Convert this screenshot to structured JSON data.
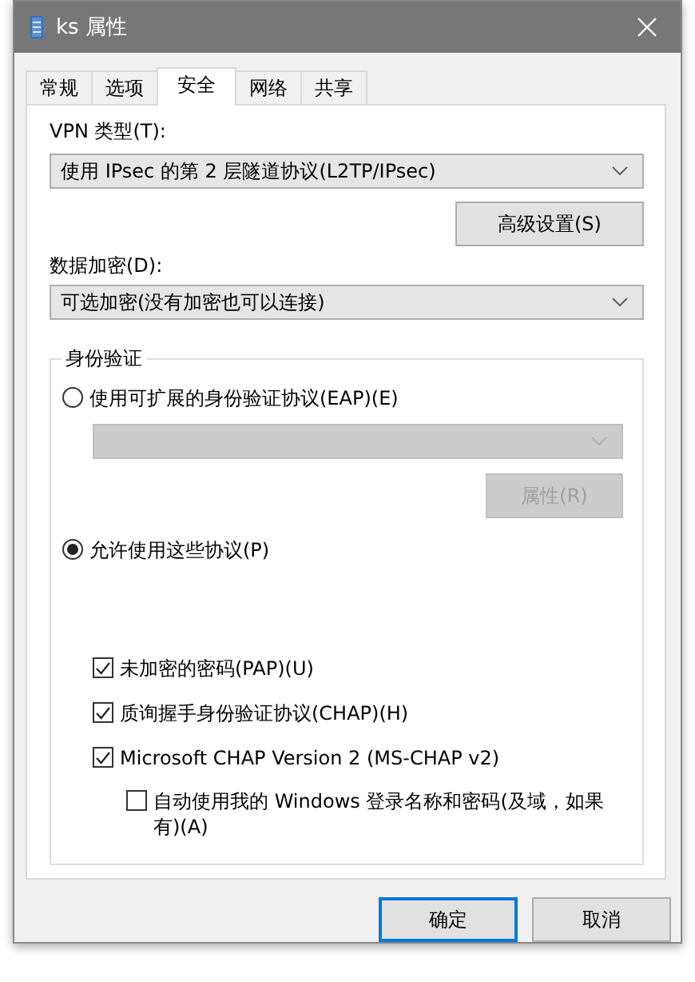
{
  "window": {
    "title": "ks 属性"
  },
  "tabs": [
    {
      "label": "常规",
      "selected": false
    },
    {
      "label": "选项",
      "selected": false
    },
    {
      "label": "安全",
      "selected": true
    },
    {
      "label": "网络",
      "selected": false
    },
    {
      "label": "共享",
      "selected": false
    }
  ],
  "vpn_type": {
    "label": "VPN 类型(T):",
    "value": "使用 IPsec 的第 2 层隧道协议(L2TP/IPsec)"
  },
  "advanced_button": {
    "label": "高级设置(S)"
  },
  "encryption": {
    "label": "数据加密(D):",
    "value": "可选加密(没有加密也可以连接)"
  },
  "authentication": {
    "title": "身份验证",
    "eap_option": {
      "label": "使用可扩展的身份验证协议(EAP)(E)",
      "selected": false
    },
    "eap_dropdown": {
      "disabled": true
    },
    "properties_button": {
      "label": "属性(R)",
      "disabled": true
    },
    "protocols_option": {
      "label": "允许使用这些协议(P)",
      "selected": true
    },
    "protocols": [
      {
        "label": "未加密的密码(PAP)(U)",
        "checked": true
      },
      {
        "label": "质询握手身份验证协议(CHAP)(H)",
        "checked": true
      },
      {
        "label": "Microsoft CHAP Version 2 (MS-CHAP v2)",
        "checked": true,
        "children": [
          {
            "label": "自动使用我的 Windows 登录名称和密码(及域，如果有)(A)",
            "checked": false
          }
        ]
      }
    ]
  },
  "buttons": [
    {
      "label": "确定",
      "default": true
    },
    {
      "label": "取消",
      "default": false
    }
  ]
}
